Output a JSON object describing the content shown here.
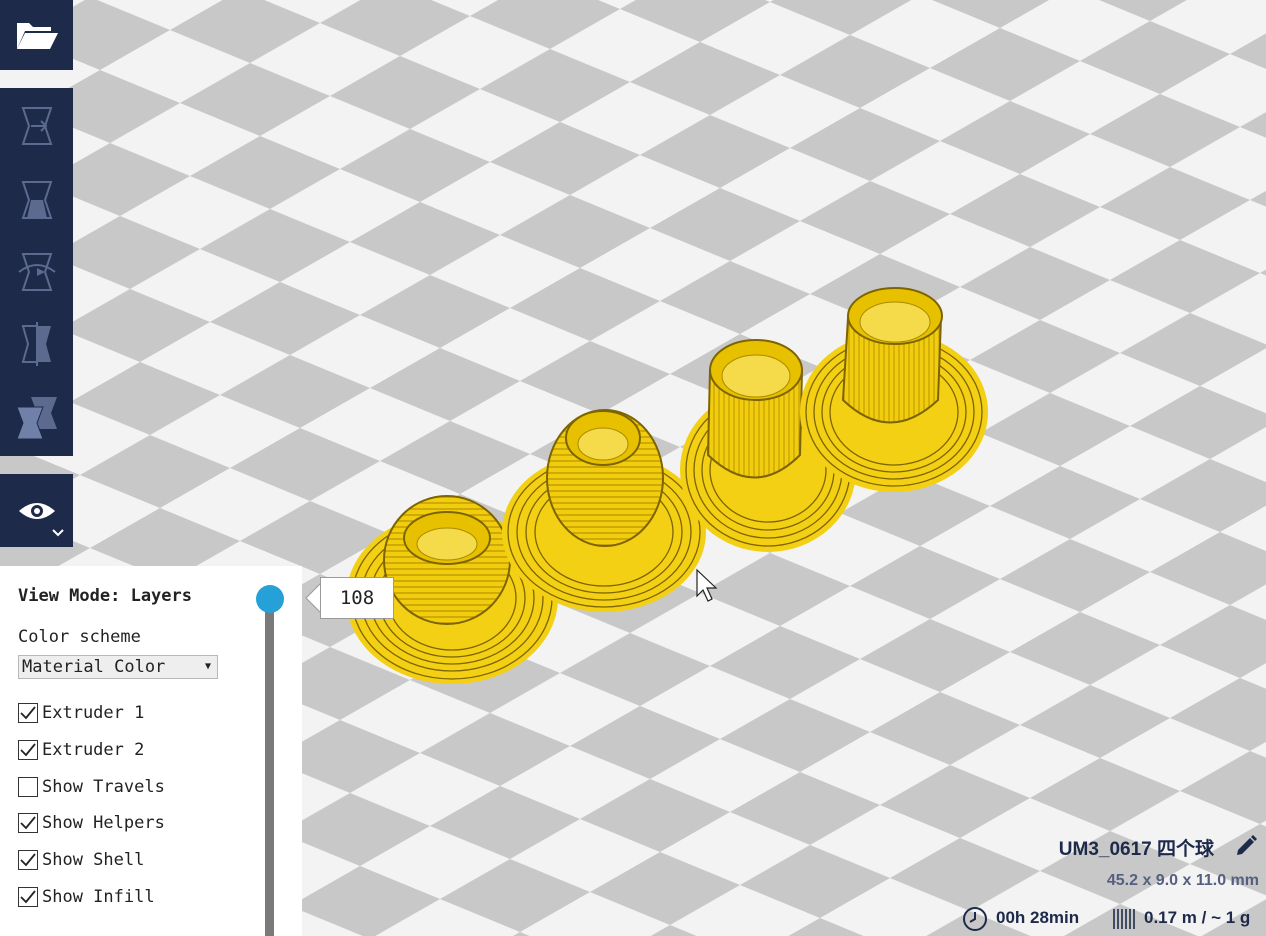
{
  "toolbar": {
    "open_icon": "folder-open-icon",
    "tools": [
      "translate-icon",
      "scale-icon",
      "rotate-icon",
      "mirror-icon",
      "per-model-settings-icon"
    ],
    "view_icon": "eye-icon"
  },
  "layer_panel": {
    "title": "View Mode: Layers",
    "color_scheme_label": "Color scheme",
    "color_scheme_value": "Material Color",
    "checkboxes": [
      {
        "label": "Extruder 1",
        "checked": true
      },
      {
        "label": "Extruder 2",
        "checked": true
      },
      {
        "label": "Show Travels",
        "checked": false
      },
      {
        "label": "Show Helpers",
        "checked": true
      },
      {
        "label": "Show Shell",
        "checked": true
      },
      {
        "label": "Show Infill",
        "checked": true
      }
    ],
    "current_layer": "108"
  },
  "job": {
    "name": "UM3_0617 四个球",
    "dimensions": "45.2 x 9.0 x 11.0 mm",
    "print_time": "00h 28min",
    "material": "0.17 m / ~ 1 g"
  },
  "colors": {
    "toolbar_bg": "#1e2a4a",
    "model_yellow": "#f4cf0c",
    "slider_handle": "#26a1d8"
  }
}
